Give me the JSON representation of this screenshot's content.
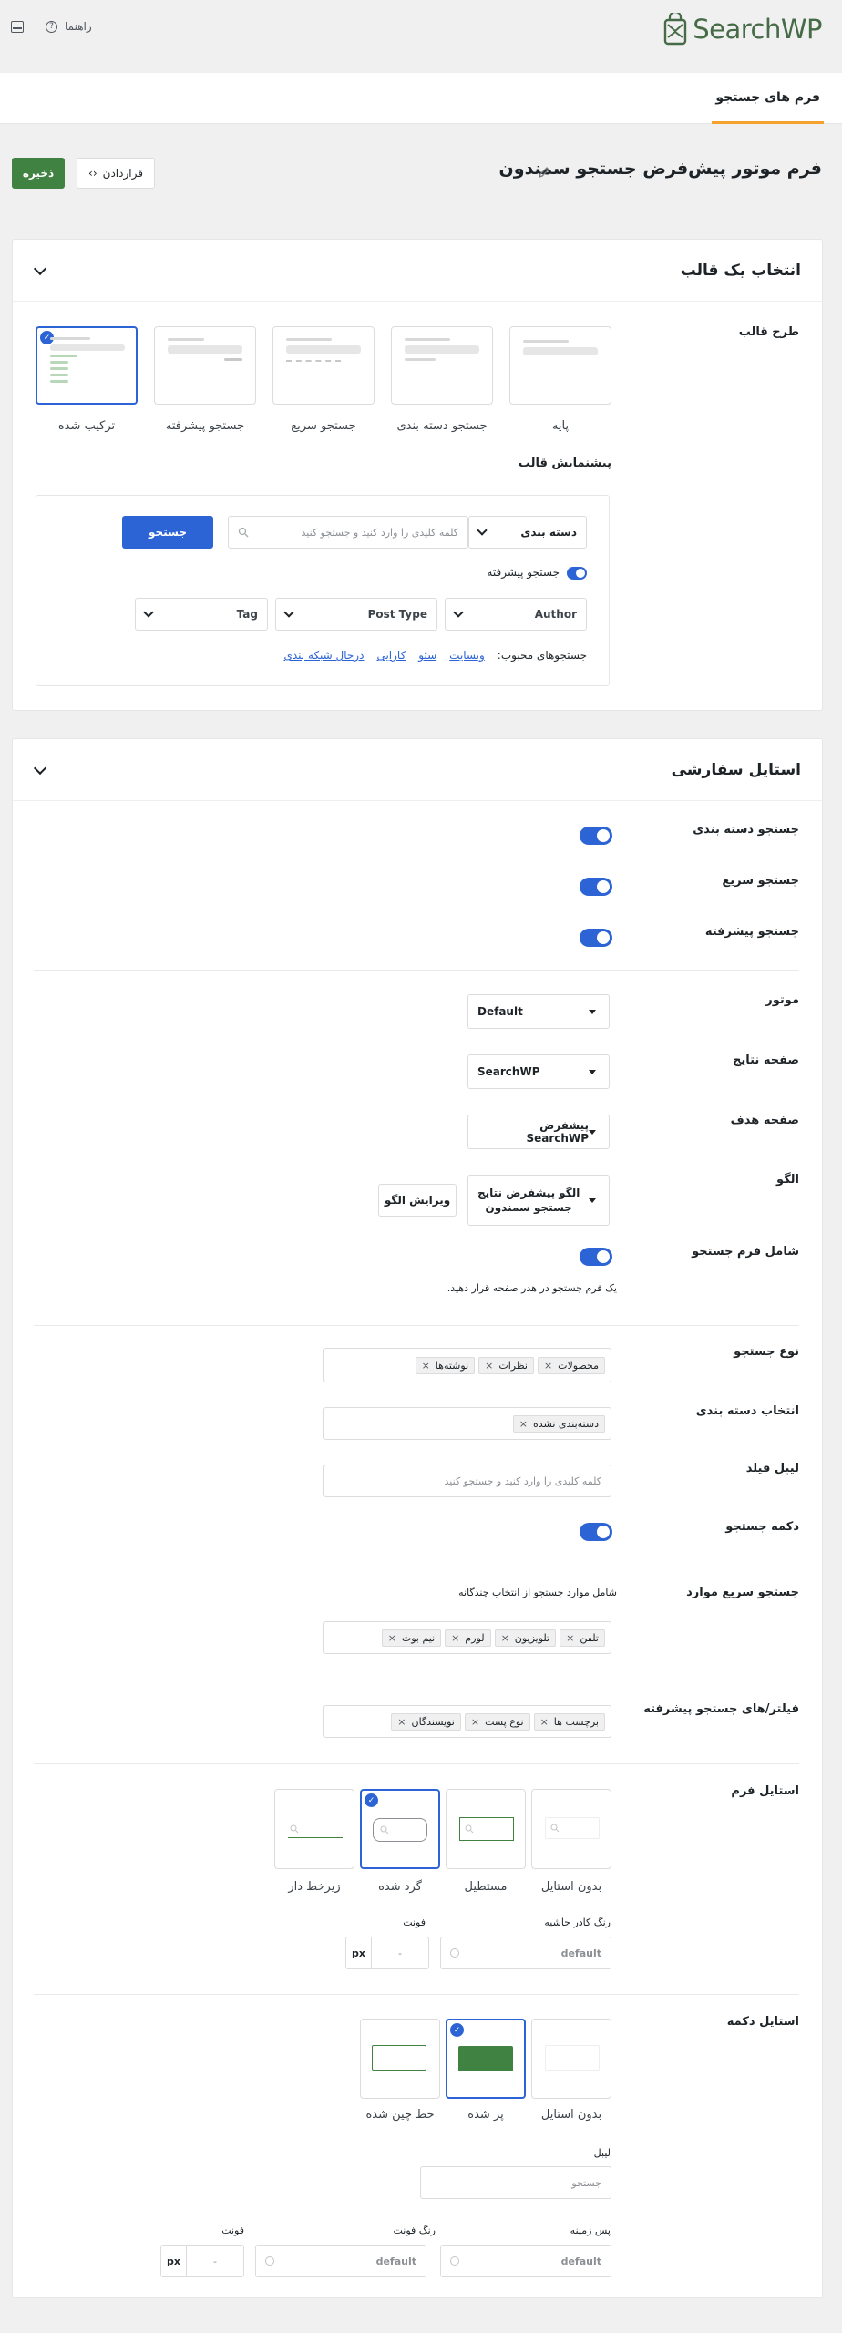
{
  "app": {
    "logo_text": "SearchWP",
    "help_label": "راهنما"
  },
  "tabs": {
    "active": "فرم های جستجو"
  },
  "header": {
    "title": "فرم موتور پیش‌فرض جستجو سمندون",
    "embed_label": "قراردادن",
    "embed_code": "‹›",
    "save_label": "ذخیره"
  },
  "templates": {
    "section_title": "انتخاب یک قالب",
    "layout_label": "طرح قالب",
    "items": [
      {
        "name": "پایه"
      },
      {
        "name": "جستجو دسته بندی"
      },
      {
        "name": "جستجو سریع"
      },
      {
        "name": "جستجو پیشرفته"
      },
      {
        "name": "ترکیب شده",
        "selected": true
      }
    ],
    "preview_label": "پیشنمایش قالب",
    "preview": {
      "category_select": "دسته بندی",
      "search_placeholder": "کلمه کلیدی را وارد کنید و جستجو کنید",
      "search_button": "جستجو",
      "advanced_toggle": "جستجو پیشرفته",
      "filters": [
        "Author",
        "Post Type",
        "Tag"
      ],
      "popular_label": "جستجوهای محبوب:",
      "popular_links": [
        "وبسایت",
        "سئو",
        "کارایی",
        "درحال شبکه بندی"
      ]
    }
  },
  "custom": {
    "section_title": "استایل سفارشی",
    "toggles": [
      {
        "label": "جستجو دسته بندی",
        "on": true
      },
      {
        "label": "جستجو سریع",
        "on": true
      },
      {
        "label": "جستجو پیشرفته",
        "on": true
      }
    ],
    "engine": {
      "label": "موتور",
      "value": "Default"
    },
    "results_page": {
      "label": "صفحه نتایج",
      "value": "SearchWP"
    },
    "target_page": {
      "label": "صفحه هدف",
      "value": "پیشفرض SearchWP"
    },
    "template": {
      "label": "الگو",
      "value_line1": "الگو پیشفرض نتایج",
      "value_line2": "جستجو سمندون",
      "edit_button": "ویرایش الگو"
    },
    "include_form": {
      "label": "شامل فرم جستجو",
      "on": true,
      "help": "یک فرم جستجو در هدر صفحه قرار دهید."
    },
    "search_type": {
      "label": "نوع جستجو",
      "chips": [
        "محصولات",
        "نظرات",
        "نوشته‌ها"
      ]
    },
    "category_select": {
      "label": "انتخاب دسته بندی",
      "chips": [
        "دسته‌بندی نشده"
      ]
    },
    "field_label": {
      "label": "لیبل فیلد",
      "placeholder": "کلمه کلیدی را وارد کنید و جستجو کنید"
    },
    "search_button": {
      "label": "دکمه جستجو",
      "on": true
    },
    "quick_items": {
      "label": "جستجو سریع موارد",
      "help": "شامل موارد جستجو از انتخاب چندگانه",
      "chips": [
        "تلفن",
        "تلویزیون",
        "لورم",
        "نیم بوت"
      ]
    },
    "advanced_filters": {
      "label": "فیلتر/های جستجو پیشرفته",
      "chips": [
        "برچسب ها",
        "نوع پست",
        "نویسندگان"
      ]
    },
    "form_style": {
      "label": "استایل فرم",
      "options": [
        {
          "name": "بدون استایل"
        },
        {
          "name": "مستطیل"
        },
        {
          "name": "گرد شده",
          "selected": true
        },
        {
          "name": "زیرخط دار"
        }
      ],
      "border_color_label": "رنگ کادر حاشیه",
      "border_color_value": "default",
      "font_label": "فونت",
      "font_value": "-",
      "font_unit": "px"
    },
    "button_style": {
      "label": "استایل دکمه",
      "options": [
        {
          "name": "بدون استایل"
        },
        {
          "name": "پر شده",
          "selected": true
        },
        {
          "name": "خط چین شده"
        }
      ],
      "label_field_label": "لیبل",
      "label_field_placeholder": "جستجو",
      "bg_label": "پس زمینه",
      "bg_value": "default",
      "font_color_label": "رنگ فونت",
      "font_color_value": "default",
      "font_label": "فونت",
      "font_value": "-",
      "font_unit": "px"
    }
  },
  "colors": {
    "brand_green": "#456b47",
    "save_green": "#408241",
    "accent_blue": "#2c64d6",
    "tab_orange": "#f4a12e"
  }
}
